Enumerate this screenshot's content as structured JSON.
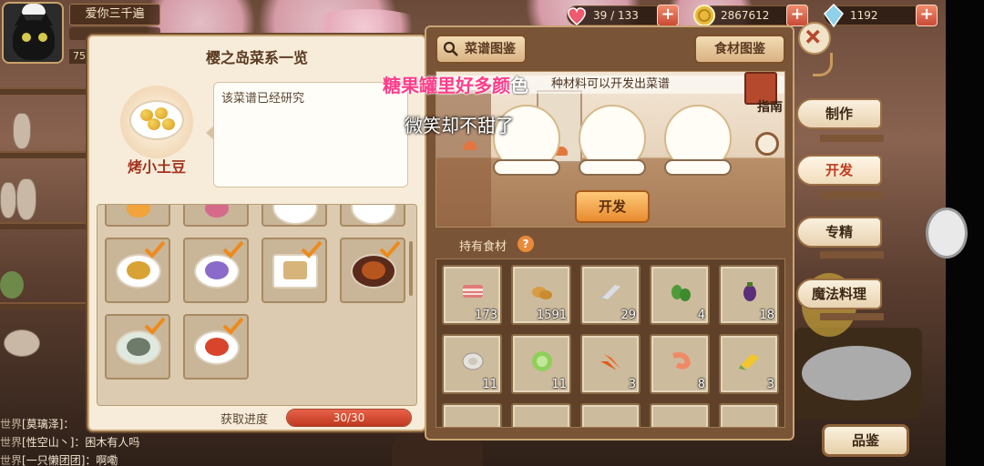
{
  "hud": {
    "player_name": "爱你三千遍",
    "level": "75",
    "stamina": "39 / 133",
    "gold": "2867612",
    "gems": "1192"
  },
  "left_panel": {
    "title": "樱之岛菜系一览",
    "selected_dish": "烤小土豆",
    "description": "该菜谱已经研究",
    "progress_label": "获取进度",
    "progress_text": "30/30",
    "progress_value": 1.0
  },
  "right_panel": {
    "tab_recipes": "菜谱图鉴",
    "tab_ingredients": "食材图鉴",
    "hint": "种材料可以开发出菜谱",
    "guide": "指南",
    "develop_button": "开发",
    "inventory_label": "持有食材",
    "ingredients": [
      {
        "icon": "bacon-icon",
        "count": "173"
      },
      {
        "icon": "potato-icon",
        "count": "1591"
      },
      {
        "icon": "fish-icon",
        "count": "29"
      },
      {
        "icon": "green-pepper-icon",
        "count": "4"
      },
      {
        "icon": "eggplant-icon",
        "count": "18"
      },
      {
        "icon": "oyster-icon",
        "count": "11"
      },
      {
        "icon": "lettuce-icon",
        "count": "11"
      },
      {
        "icon": "carrot-icon",
        "count": "3"
      },
      {
        "icon": "shrimp-icon",
        "count": "8"
      },
      {
        "icon": "corn-icon",
        "count": "3"
      }
    ]
  },
  "side_menu": {
    "make": "制作",
    "develop": "开发",
    "specialize": "专精",
    "magic_cooking": "魔法料理",
    "encyclopedia": "品鉴"
  },
  "chat": [
    {
      "channel": "世界",
      "text": "[莫璃泽]："
    },
    {
      "channel": "世界",
      "text": "[性空山丶]：困木有人吗"
    },
    {
      "channel": "世界",
      "text": "[一只懒团团]：啊嘞"
    }
  ],
  "overlay": {
    "lyric_line1_pink": "糖果罐里好多颜",
    "lyric_line1_white": "色",
    "lyric_line2": "微笑却不甜了"
  },
  "colors": {
    "accent_red": "#c23a1e",
    "progress_fill": "#e8624a",
    "lyric_pink": "#ff3d8a"
  }
}
